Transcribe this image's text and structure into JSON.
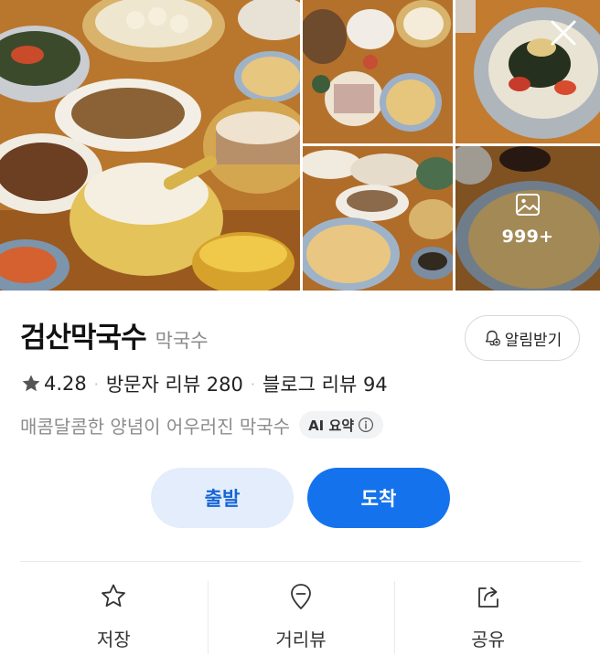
{
  "gallery": {
    "photo_count_label": "999+"
  },
  "place": {
    "name": "검산막국수",
    "category": "막국수"
  },
  "notify": {
    "label": "알림받기"
  },
  "stats": {
    "rating": "4.28",
    "visitor_reviews": "방문자 리뷰 280",
    "blog_reviews": "블로그 리뷰 94",
    "separator": "·"
  },
  "summary": {
    "text": "매콤달콤한 양념이 어우러진 막국수",
    "ai_badge": "AI 요약"
  },
  "route": {
    "depart_label": "출발",
    "arrive_label": "도착"
  },
  "actions": [
    {
      "label": "저장",
      "icon": "star-outline-icon"
    },
    {
      "label": "거리뷰",
      "icon": "street-view-pin-icon"
    },
    {
      "label": "공유",
      "icon": "share-icon"
    }
  ],
  "colors": {
    "primary": "#1473ec",
    "primary_soft": "#e3edfb",
    "text_muted": "#8c8c8c"
  }
}
